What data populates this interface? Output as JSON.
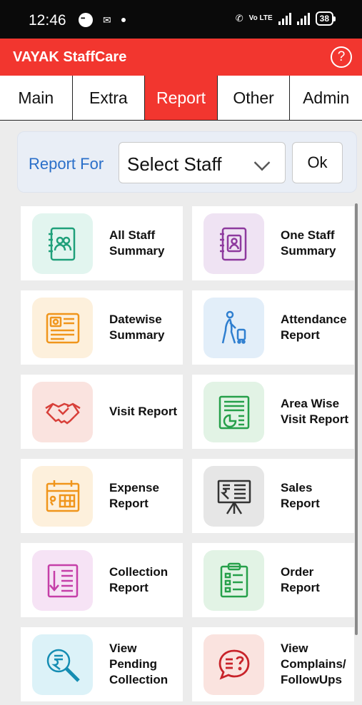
{
  "status_bar": {
    "time": "12:46",
    "left_icons": [
      "chat-bubble-icon",
      "mail-icon",
      "dot-icon"
    ],
    "network_label": "Vo LTE",
    "battery": "38"
  },
  "app_bar": {
    "title": "VAYAK StaffCare",
    "help_glyph": "?"
  },
  "tabs": [
    {
      "label": "Main",
      "active": false
    },
    {
      "label": "Extra",
      "active": false
    },
    {
      "label": "Report",
      "active": true
    },
    {
      "label": "Other",
      "active": false
    },
    {
      "label": "Admin",
      "active": false
    }
  ],
  "report_for": {
    "label": "Report For",
    "select_value": "Select Staff",
    "ok_label": "Ok"
  },
  "cards": [
    {
      "label": "All Staff\nSummary",
      "icon": "group-book-icon",
      "tile_color": "#e2f5ef"
    },
    {
      "label": "One Staff\nSummary",
      "icon": "person-book-icon",
      "tile_color": "#efe3f3"
    },
    {
      "label": "Datewise\nSummary",
      "icon": "date-document-icon",
      "tile_color": "#fdf0dc"
    },
    {
      "label": "Attendance\nReport",
      "icon": "traveler-luggage-icon",
      "tile_color": "#e2eef9"
    },
    {
      "label": "Visit Report",
      "icon": "handshake-icon",
      "tile_color": "#fae3df"
    },
    {
      "label": "Area Wise\nVisit Report",
      "icon": "area-report-icon",
      "tile_color": "#e2f3e5"
    },
    {
      "label": "Expense\nReport",
      "icon": "calendar-icon",
      "tile_color": "#fdf0dc"
    },
    {
      "label": "Sales\nReport",
      "icon": "sales-board-icon",
      "tile_color": "#e6e6e6"
    },
    {
      "label": "Collection\nReport",
      "icon": "collection-list-icon",
      "tile_color": "#f6e3f5"
    },
    {
      "label": "Order\nReport",
      "icon": "clipboard-icon",
      "tile_color": "#e2f3e5"
    },
    {
      "label": "View\nPending\nCollection",
      "icon": "rupee-search-icon",
      "tile_color": "#dcf2f8"
    },
    {
      "label": "View\nComplains/\nFollowUps",
      "icon": "question-chat-icon",
      "tile_color": "#fae3df"
    }
  ]
}
